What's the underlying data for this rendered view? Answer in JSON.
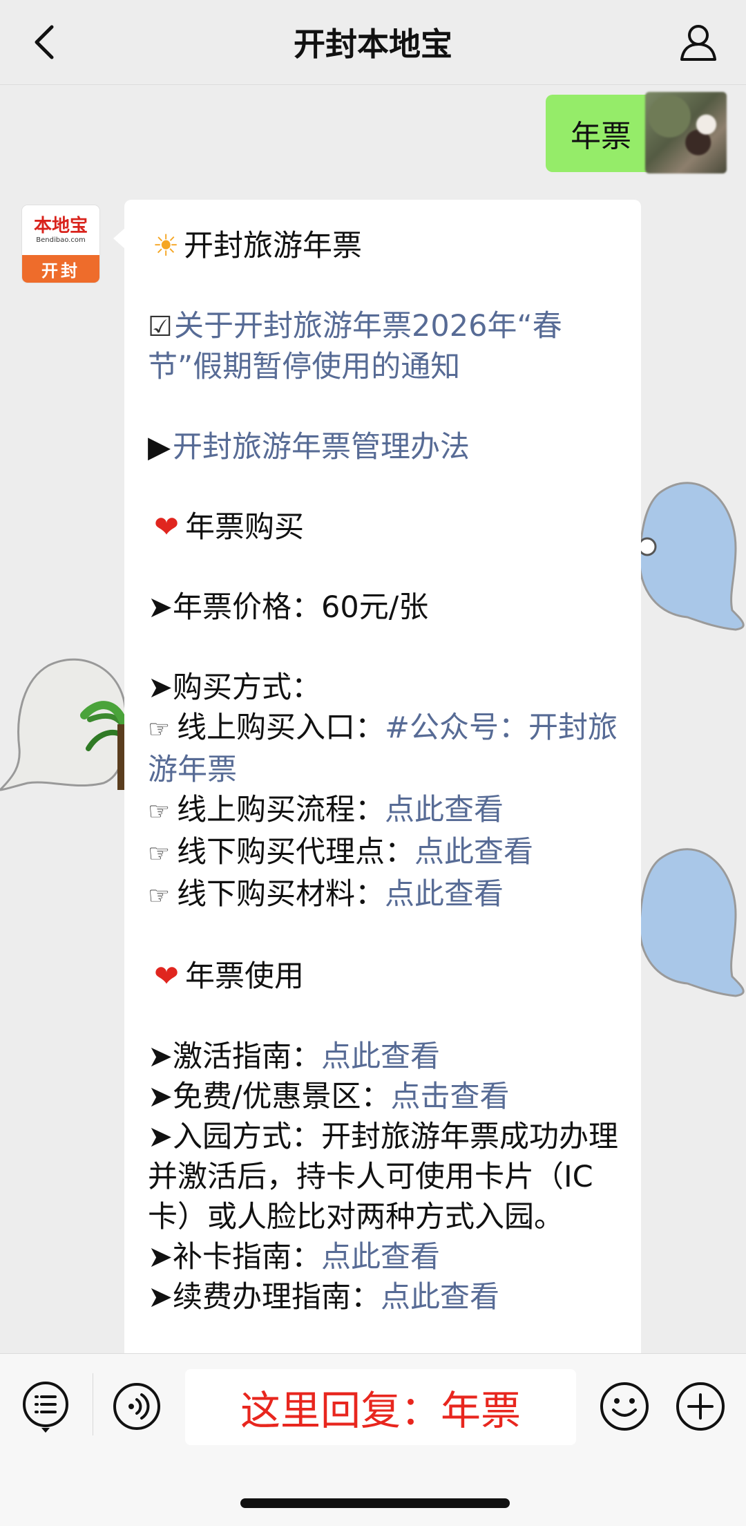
{
  "header": {
    "title": "开封本地宝"
  },
  "user_message": {
    "text": "年票"
  },
  "bot_avatar": {
    "logo_cn": "本地宝",
    "logo_en": "Bendibao.com",
    "city": "开封"
  },
  "reply": {
    "heading": "开封旅游年票",
    "notice_link": "关于开封旅游年票2026年“春节”假期暂停使用的通知",
    "rules_link": "开封旅游年票管理办法",
    "purchase_heading": "年票购买",
    "price_label": "年票价格：",
    "price_value": "60元/张",
    "method_label": "购买方式：",
    "online_entry_label": "线上购买入口：",
    "online_entry_link": "#公众号：开封旅游年票",
    "online_process_label": "线上购买流程：",
    "online_process_link": "点此查看",
    "offline_agent_label": "线下购买代理点：",
    "offline_agent_link": "点此查看",
    "offline_material_label": "线下购买材料：",
    "offline_material_link": "点此查看",
    "usage_heading": "年票使用",
    "activate_label": "激活指南：",
    "activate_link": "点此查看",
    "scenic_label": "免费/优惠景区：",
    "scenic_link": "点击查看",
    "entry_label": "入园方式：",
    "entry_text": "开封旅游年票成功办理并激活后，持卡人可使用卡片（IC卡）或人脸比对两种方式入园。",
    "reissue_label": "补卡指南：",
    "reissue_link": "点此查看",
    "renew_label": "续费办理指南：",
    "renew_link": "点此查看"
  },
  "bottom_bar": {
    "input_text": "这里回复：年票"
  },
  "colors": {
    "link": "#576b95",
    "outgoing_bubble": "#95ec69",
    "prompt_text": "#e8261e"
  }
}
